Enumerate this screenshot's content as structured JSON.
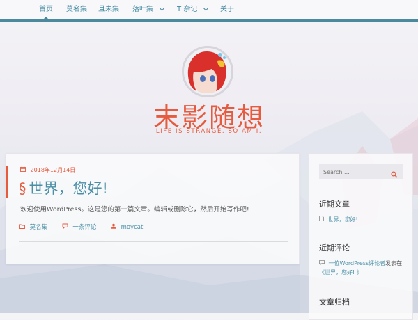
{
  "nav": {
    "items": [
      {
        "label": "首页",
        "dropdown": false,
        "active": true
      },
      {
        "label": "莫名集",
        "dropdown": false,
        "active": false
      },
      {
        "label": "且未集",
        "dropdown": false,
        "active": false
      },
      {
        "label": "落叶集",
        "dropdown": true,
        "active": false
      },
      {
        "label": "IT 杂记",
        "dropdown": true,
        "active": false
      },
      {
        "label": "关于",
        "dropdown": false,
        "active": false
      }
    ]
  },
  "header": {
    "site_title": "末影随想",
    "tagline": "LIFE IS STRANGE. SO AM I."
  },
  "post": {
    "date": "2018年12月14日",
    "title_prefix": "§",
    "title": "世界，您好!",
    "excerpt": "欢迎使用WordPress。这是您的第一篇文章。编辑或删除它，然后开始写作吧!",
    "category": "莫名集",
    "comments": "一条评论",
    "author": "moycat"
  },
  "sidebar": {
    "search_placeholder": "Search ...",
    "recent_posts_title": "近期文章",
    "recent_posts": [
      "世界，您好!"
    ],
    "recent_comments_title": "近期评论",
    "recent_comment": {
      "author": "一位WordPress评论者",
      "verb": "发表在",
      "post": "《世界，您好! 》"
    },
    "archives_title": "文章归档"
  },
  "colors": {
    "accent": "#e65a3e",
    "link": "#4a8fa6",
    "nav_line": "#4a8a9c"
  },
  "icons": {
    "calendar": "calendar-icon",
    "folder": "folder-icon",
    "comment": "comment-icon",
    "user": "user-icon",
    "search": "search-icon",
    "document": "document-icon"
  }
}
